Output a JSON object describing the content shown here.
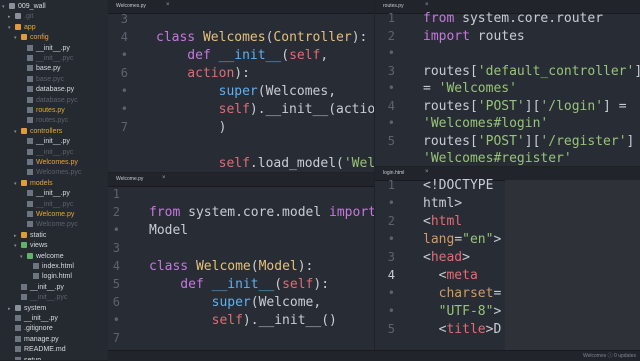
{
  "sidebar": {
    "items": [
      {
        "label": "009_wall",
        "depth": 0,
        "kind": "folder-grey",
        "expanded": true,
        "style": "sel"
      },
      {
        "label": ".git",
        "depth": 1,
        "kind": "folder-grey",
        "expanded": false,
        "style": "dim"
      },
      {
        "label": "app",
        "depth": 1,
        "kind": "folder",
        "expanded": true,
        "style": "hl"
      },
      {
        "label": "config",
        "depth": 2,
        "kind": "folder",
        "expanded": true,
        "style": "hl"
      },
      {
        "label": "__init__.py",
        "depth": 3,
        "kind": "file",
        "style": "sel"
      },
      {
        "label": "__init__.pyc",
        "depth": 3,
        "kind": "file",
        "style": "dim"
      },
      {
        "label": "base.py",
        "depth": 3,
        "kind": "file",
        "style": "sel"
      },
      {
        "label": "base.pyc",
        "depth": 3,
        "kind": "file",
        "style": "dim"
      },
      {
        "label": "database.py",
        "depth": 3,
        "kind": "file",
        "style": "sel"
      },
      {
        "label": "database.pyc",
        "depth": 3,
        "kind": "file",
        "style": "dim"
      },
      {
        "label": "routes.py",
        "depth": 3,
        "kind": "file",
        "style": "hl"
      },
      {
        "label": "routes.pyc",
        "depth": 3,
        "kind": "file",
        "style": "dim"
      },
      {
        "label": "controllers",
        "depth": 2,
        "kind": "folder",
        "expanded": true,
        "style": "hl"
      },
      {
        "label": "__init__.py",
        "depth": 3,
        "kind": "file",
        "style": "sel"
      },
      {
        "label": "__init__.pyc",
        "depth": 3,
        "kind": "file",
        "style": "dim"
      },
      {
        "label": "Welcomes.py",
        "depth": 3,
        "kind": "file",
        "style": "hl"
      },
      {
        "label": "Welcomes.pyc",
        "depth": 3,
        "kind": "file",
        "style": "dim"
      },
      {
        "label": "models",
        "depth": 2,
        "kind": "folder",
        "expanded": true,
        "style": "hl"
      },
      {
        "label": "__init__.py",
        "depth": 3,
        "kind": "file",
        "style": "sel"
      },
      {
        "label": "__init__.pyc",
        "depth": 3,
        "kind": "file",
        "style": "dim"
      },
      {
        "label": "Welcome.py",
        "depth": 3,
        "kind": "file",
        "style": "hl"
      },
      {
        "label": "Welcome.pyc",
        "depth": 3,
        "kind": "file",
        "style": "dim"
      },
      {
        "label": "static",
        "depth": 2,
        "kind": "folder",
        "expanded": false,
        "style": "sel"
      },
      {
        "label": "views",
        "depth": 2,
        "kind": "folder-green",
        "expanded": true,
        "style": "sel"
      },
      {
        "label": "welcome",
        "depth": 3,
        "kind": "folder-green",
        "expanded": true,
        "style": "sel"
      },
      {
        "label": "index.html",
        "depth": 4,
        "kind": "file",
        "style": "sel"
      },
      {
        "label": "login.html",
        "depth": 4,
        "kind": "file",
        "style": "sel"
      },
      {
        "label": "__init__.py",
        "depth": 2,
        "kind": "file",
        "style": "sel"
      },
      {
        "label": "__init__.pyc",
        "depth": 2,
        "kind": "file",
        "style": "dim"
      },
      {
        "label": "system",
        "depth": 1,
        "kind": "folder-grey",
        "expanded": false,
        "style": "sel"
      },
      {
        "label": "__init__.py",
        "depth": 1,
        "kind": "file",
        "style": "sel"
      },
      {
        "label": ".gitignore",
        "depth": 1,
        "kind": "file",
        "style": "sel"
      },
      {
        "label": "manage.py",
        "depth": 1,
        "kind": "file",
        "style": "sel"
      },
      {
        "label": "README.md",
        "depth": 1,
        "kind": "file",
        "style": "sel"
      },
      {
        "label": "setup",
        "depth": 1,
        "kind": "file",
        "style": "sel"
      },
      {
        "label": "wsgi.py",
        "depth": 1,
        "kind": "file",
        "style": "sel"
      }
    ]
  },
  "panes": {
    "top_left": {
      "tab": "Welcomes.py",
      "gutter": [
        "3",
        "4",
        "•",
        "6",
        "•",
        "•",
        "7"
      ],
      "lines": [
        [],
        [
          {
            "t": "class ",
            "c": "kw"
          },
          {
            "t": "Welcomes",
            "c": "cls"
          },
          {
            "t": "(",
            "c": "pl"
          },
          {
            "t": "Controller",
            "c": "cls"
          },
          {
            "t": "):",
            "c": "pl"
          }
        ],
        [
          {
            "t": "    def ",
            "c": "kw"
          },
          {
            "t": "__init__",
            "c": "fn"
          },
          {
            "t": "(",
            "c": "pl"
          },
          {
            "t": "self",
            "c": "slf"
          },
          {
            "t": ",",
            "c": "pl"
          }
        ],
        [
          {
            "t": "    action",
            "c": "slf"
          },
          {
            "t": "):",
            "c": "pl"
          }
        ],
        [
          {
            "t": "        super",
            "c": "fn"
          },
          {
            "t": "(Welcomes,",
            "c": "pl"
          }
        ],
        [
          {
            "t": "        self",
            "c": "slf"
          },
          {
            "t": ").__init__(action",
            "c": "pl"
          }
        ],
        [
          {
            "t": "        )",
            "c": "pl"
          }
        ],
        [],
        [
          {
            "t": "        self",
            "c": "slf"
          },
          {
            "t": ".load_model(",
            "c": "pl"
          },
          {
            "t": "'Welc",
            "c": "str"
          }
        ]
      ]
    },
    "top_right": {
      "tab": "routes.py",
      "gutter": [
        "1",
        "2",
        "•",
        "3",
        "•",
        "4",
        "•",
        "5"
      ],
      "lines": [
        [
          {
            "t": "from ",
            "c": "kw"
          },
          {
            "t": "system.core.router",
            "c": "pl"
          }
        ],
        [
          {
            "t": "import ",
            "c": "kw"
          },
          {
            "t": "routes",
            "c": "pl"
          }
        ],
        [],
        [
          {
            "t": "routes[",
            "c": "pl"
          },
          {
            "t": "'default_controller'",
            "c": "str"
          },
          {
            "t": "]",
            "c": "pl"
          }
        ],
        [
          {
            "t": "= ",
            "c": "pl"
          },
          {
            "t": "'Welcomes'",
            "c": "str"
          }
        ],
        [
          {
            "t": "routes[",
            "c": "pl"
          },
          {
            "t": "'POST'",
            "c": "str"
          },
          {
            "t": "][",
            "c": "pl"
          },
          {
            "t": "'/login'",
            "c": "str"
          },
          {
            "t": "] =",
            "c": "pl"
          }
        ],
        [
          {
            "t": "'Welcomes#login'",
            "c": "str"
          }
        ],
        [
          {
            "t": "routes[",
            "c": "pl"
          },
          {
            "t": "'POST'",
            "c": "str"
          },
          {
            "t": "][",
            "c": "pl"
          },
          {
            "t": "'/register'",
            "c": "str"
          },
          {
            "t": "] =",
            "c": "pl"
          }
        ],
        [
          {
            "t": "'Welcomes#register'",
            "c": "str"
          }
        ]
      ]
    },
    "bottom_left": {
      "tab": "Welcome.py",
      "gutter": [
        "1",
        "2",
        "•",
        "3",
        "4",
        "5",
        "6",
        "•",
        "7"
      ],
      "lines": [
        [],
        [
          {
            "t": "from ",
            "c": "kw"
          },
          {
            "t": "system.core.model ",
            "c": "pl"
          },
          {
            "t": "import",
            "c": "kw"
          }
        ],
        [
          {
            "t": "Model",
            "c": "pl"
          }
        ],
        [],
        [
          {
            "t": "class ",
            "c": "kw"
          },
          {
            "t": "Welcome",
            "c": "cls"
          },
          {
            "t": "(",
            "c": "pl"
          },
          {
            "t": "Model",
            "c": "cls"
          },
          {
            "t": "):",
            "c": "pl"
          }
        ],
        [
          {
            "t": "    def ",
            "c": "kw"
          },
          {
            "t": "__init__",
            "c": "fn"
          },
          {
            "t": "(",
            "c": "pl"
          },
          {
            "t": "self",
            "c": "slf"
          },
          {
            "t": "):",
            "c": "pl"
          }
        ],
        [
          {
            "t": "        super",
            "c": "fn"
          },
          {
            "t": "(Welcome,",
            "c": "pl"
          }
        ],
        [
          {
            "t": "        self",
            "c": "slf"
          },
          {
            "t": ").__init__()",
            "c": "pl"
          }
        ]
      ]
    },
    "bottom_right": {
      "tab": "login.html",
      "gutter": [
        "1",
        "•",
        "2",
        "•",
        "3",
        "4",
        "•",
        "•",
        "5"
      ],
      "current_line": "4",
      "lines": [
        [
          {
            "t": "<!DOCTYPE",
            "c": "pl"
          }
        ],
        [
          {
            "t": "html>",
            "c": "pl"
          }
        ],
        [
          {
            "t": "<",
            "c": "pl"
          },
          {
            "t": "html",
            "c": "tag"
          }
        ],
        [
          {
            "t": "lang",
            "c": "attr"
          },
          {
            "t": "=",
            "c": "pl"
          },
          {
            "t": "\"en\"",
            "c": "str"
          },
          {
            "t": ">",
            "c": "pl"
          }
        ],
        [
          {
            "t": "<",
            "c": "pl"
          },
          {
            "t": "head",
            "c": "tag"
          },
          {
            "t": ">",
            "c": "pl"
          }
        ],
        [
          {
            "t": "  <",
            "c": "pl"
          },
          {
            "t": "meta",
            "c": "tag"
          }
        ],
        [
          {
            "t": "  charset",
            "c": "attr"
          },
          {
            "t": "=",
            "c": "pl"
          }
        ],
        [
          {
            "t": "  \"UTF-8\"",
            "c": "str"
          },
          {
            "t": ">",
            "c": "pl"
          }
        ],
        [
          {
            "t": "  <",
            "c": "pl"
          },
          {
            "t": "title",
            "c": "tag"
          },
          {
            "t": ">D",
            "c": "pl"
          }
        ]
      ]
    }
  },
  "statusbar": {
    "right_text": "Welcomes  ⓘ 0 updates"
  }
}
